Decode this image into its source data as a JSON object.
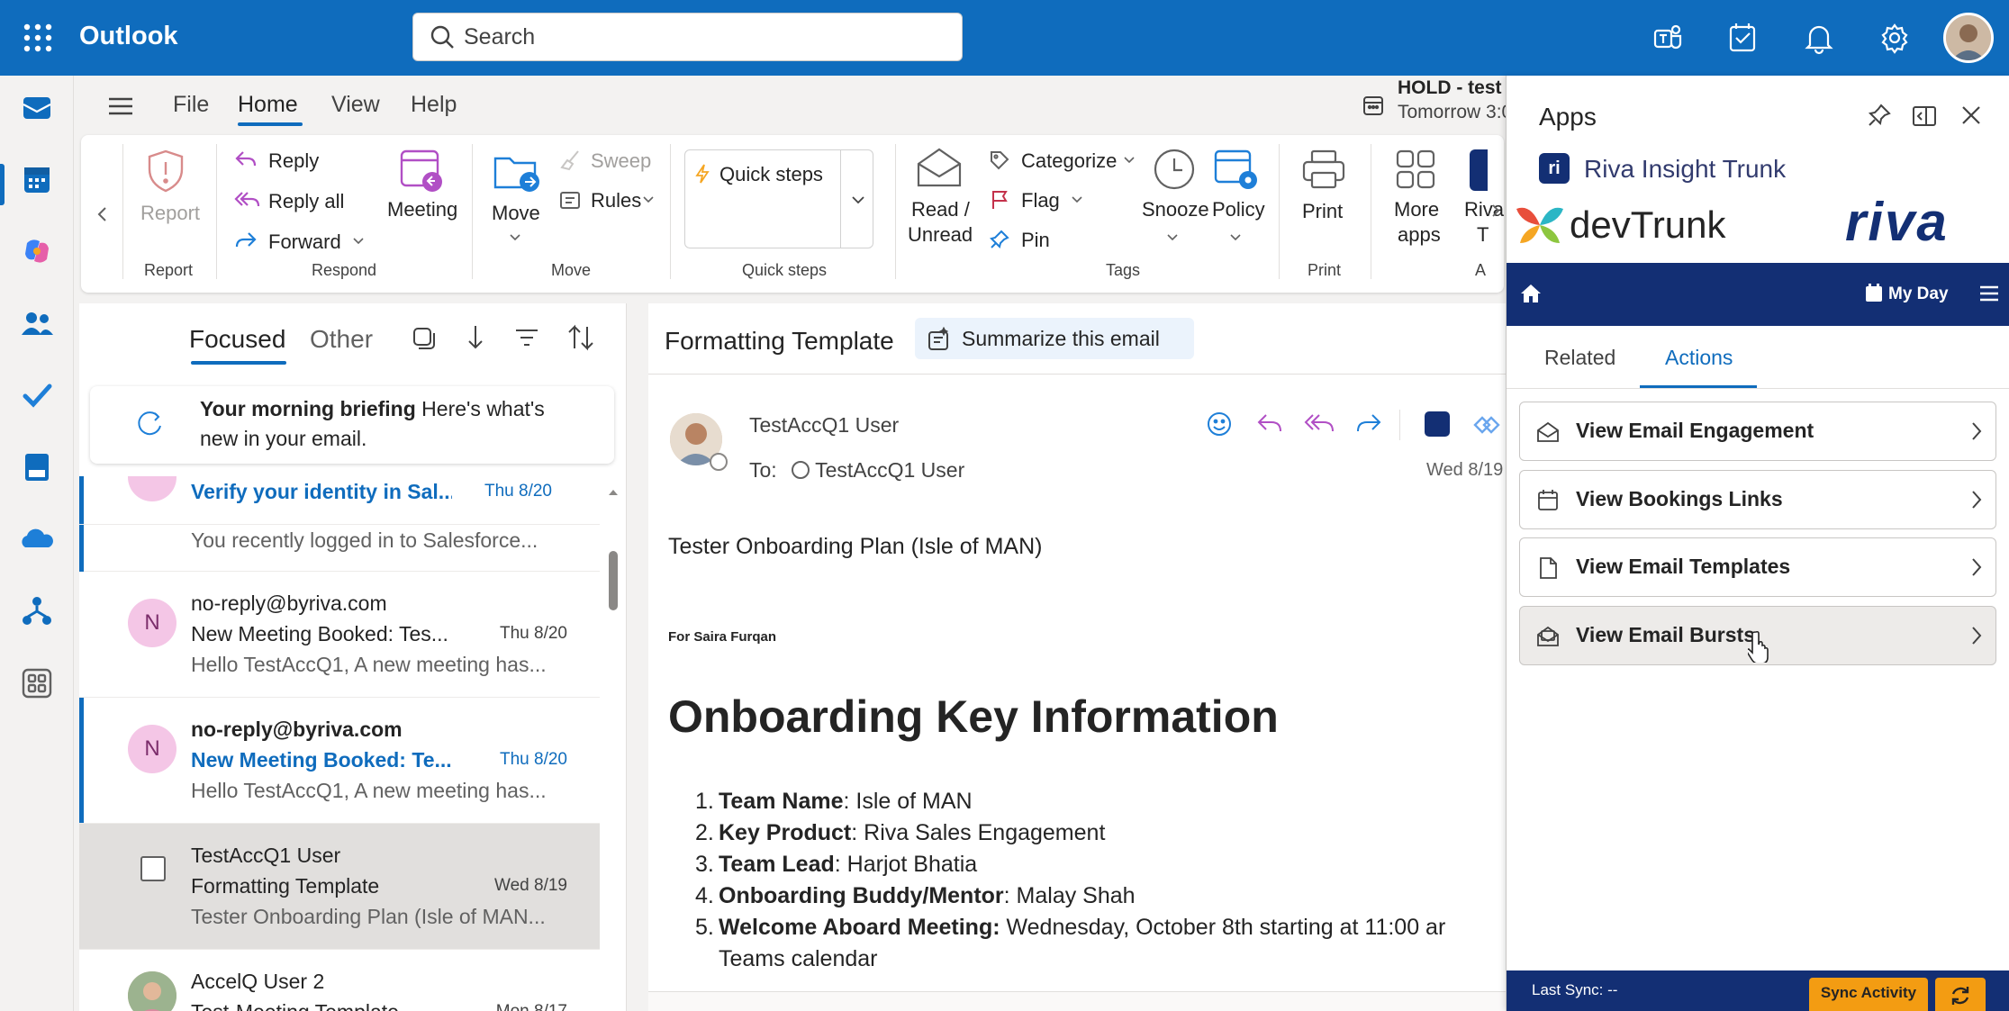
{
  "topbar": {
    "app_title": "Outlook",
    "search_placeholder": "Search",
    "brand_color": "#0f6cbd"
  },
  "menu": {
    "tabs": [
      "File",
      "Home",
      "View",
      "Help"
    ],
    "active_tab": "Home"
  },
  "reminder": {
    "title": "HOLD - test",
    "subtitle": "Tomorrow 3:0"
  },
  "ribbon": {
    "report": {
      "label": "Report",
      "group": "Report"
    },
    "respond": {
      "reply": "Reply",
      "reply_all": "Reply all",
      "forward": "Forward",
      "meeting": "Meeting",
      "group": "Respond"
    },
    "move": {
      "move": "Move",
      "sweep": "Sweep",
      "rules": "Rules",
      "group": "Move"
    },
    "quick_steps": {
      "label": "Quick steps",
      "group": "Quick steps"
    },
    "tags": {
      "read_unread_1": "Read /",
      "read_unread_2": "Unread",
      "categorize": "Categorize",
      "flag": "Flag",
      "pin": "Pin",
      "snooze": "Snooze",
      "policy": "Policy",
      "group": "Tags"
    },
    "print": {
      "label": "Print",
      "group": "Print"
    },
    "apps": {
      "more_apps_1": "More",
      "more_apps_2": "apps",
      "riva_1": "Riva",
      "riva_2": "T",
      "group": "A"
    }
  },
  "mail_list": {
    "tabs": {
      "focused": "Focused",
      "other": "Other"
    },
    "briefing": {
      "title": "Your morning briefing",
      "text_1": " Here's what's",
      "text_2": "new in your email."
    },
    "items": [
      {
        "subject": "Verify your identity in Sal...",
        "date": "Thu 8/20",
        "preview": "You recently logged in to Salesforce..."
      },
      {
        "avatar": "N",
        "from": "no-reply@byriva.com",
        "subject": "New Meeting Booked: Tes...",
        "date": "Thu 8/20",
        "preview": "Hello TestAccQ1, A new meeting has..."
      },
      {
        "avatar": "N",
        "from": "no-reply@byriva.com",
        "subject": "New Meeting Booked: Te...",
        "date": "Thu 8/20",
        "preview": "Hello TestAccQ1, A new meeting has..."
      },
      {
        "from": "TestAccQ1 User",
        "subject": "Formatting Template",
        "date": "Wed 8/19",
        "preview": "Tester Onboarding Plan (Isle of MAN..."
      },
      {
        "from": "AccelQ User 2",
        "subject": "Test-Meeting Template",
        "date": "Mon 8/17"
      }
    ]
  },
  "reading": {
    "subject": "Formatting Template",
    "summarize_label": "Summarize this email",
    "sender": "TestAccQ1 User",
    "to_label": "To:",
    "to_name": "TestAccQ1 User",
    "date": "Wed 8/19",
    "body_line1": "Tester Onboarding Plan (Isle of MAN)",
    "for_line": "For Saira Furqan",
    "heading": "Onboarding Key Information",
    "list": [
      {
        "num": "1.",
        "key": "Team Name",
        "sep": ": ",
        "value": "Isle of MAN"
      },
      {
        "num": "2.",
        "key": "Key Product",
        "sep": ": ",
        "value": "Riva Sales Engagement"
      },
      {
        "num": "3.",
        "key": "Team Lead",
        "sep": ": ",
        "value": "Harjot Bhatia"
      },
      {
        "num": "4.",
        "key": "Onboarding Buddy/Mentor",
        "sep": ": ",
        "value": "Malay Shah"
      },
      {
        "num": "5.",
        "key": "Welcome Aboard Meeting:",
        "sep": " ",
        "value": "Wednesday, October 8th starting at 11:00 ar"
      }
    ],
    "list_continuation": "Teams calendar"
  },
  "riva_panel": {
    "apps_title": "Apps",
    "insight_title": "Riva Insight Trunk",
    "devtrunk": "devTrunk",
    "riva_logo": "riva",
    "my_day": "My Day",
    "tabs": {
      "related": "Related",
      "actions": "Actions"
    },
    "actions": [
      {
        "label": "View Email Engagement",
        "icon": "envelope-open-icon"
      },
      {
        "label": "View Bookings Links",
        "icon": "calendar-icon"
      },
      {
        "label": "View Email Templates",
        "icon": "document-icon"
      },
      {
        "label": "View Email Bursts",
        "icon": "mail-burst-icon"
      }
    ],
    "last_sync": "Last Sync: --",
    "sync_activity": "Sync Activity",
    "header_color": "#132f74",
    "accent_orange": "#f39c12"
  }
}
